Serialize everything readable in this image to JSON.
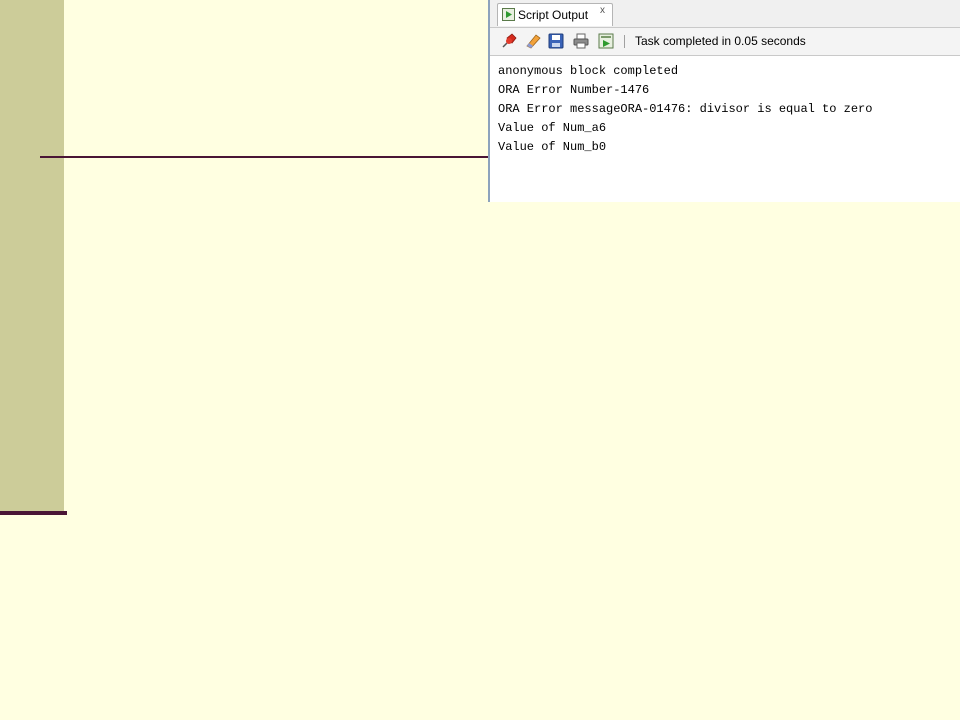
{
  "panel": {
    "tab_label": "Script Output",
    "tab_close": "x",
    "status": "Task completed in 0.05 seconds"
  },
  "toolbar": {
    "icons": [
      "pin-icon",
      "eraser-icon",
      "save-icon",
      "print-icon",
      "run-output-icon"
    ]
  },
  "output": {
    "lines": [
      "anonymous block completed",
      "ORA Error Number-1476",
      "ORA Error messageORA-01476: divisor is equal to zero",
      "Value of Num_a6",
      "Value of Num_b0"
    ]
  },
  "colors": {
    "background": "#ffffe1",
    "left_bar": "#cccc99",
    "accent_line": "#4a1535"
  }
}
